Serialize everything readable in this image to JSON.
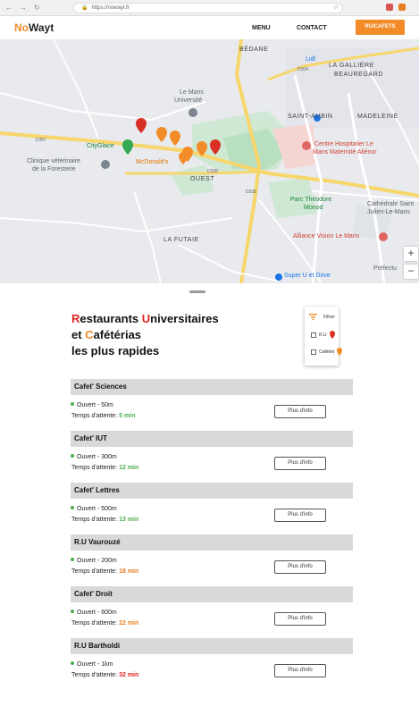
{
  "browser": {
    "url": "https://nowayt.fr"
  },
  "header": {
    "logo_no": "No",
    "logo_wayt": "Wayt",
    "menu_label": "MENU",
    "contact_label": "CONTACT",
    "cta_label": "RU/CAFETS"
  },
  "map": {
    "labels": {
      "bedane": "BÉDANE",
      "lidl": "Lidl",
      "gailliere": "LA GALLIÈRE",
      "beauregard": "BEAUREGARD",
      "universite": "Le Mans",
      "universite2": "Université",
      "saint_aubin": "SAINT-AUBIN",
      "madeleine": "MADELEINE",
      "cityglace": "CityGlace",
      "mcdonalds": "McDonald's",
      "hopital": "Centre Hospitalier Le",
      "hopital2": "Mans Maternité Aliénor",
      "clinique": "Clinique vétérinaire",
      "clinique2": "de la Foresterie",
      "ouest": "OUEST",
      "parc": "Parc Théodore",
      "parc2": "Monod",
      "cathedrale": "Cathédrale Saint",
      "cathedrale2": "Julien-Le-Mans",
      "futaie": "LA FUTAIE",
      "alliance": "Alliance Vision Le Mans",
      "super_u": "Super U et Drive",
      "prefecture": "Préfectu",
      "d357": "D357",
      "d338": "D338",
      "d304": "D304",
      "d338b": "D338"
    },
    "zoom_in": "+",
    "zoom_out": "−"
  },
  "title": {
    "l1a": "R",
    "l1b": "estaurants ",
    "l1c": "U",
    "l1d": "niversitaires",
    "l2a": "et ",
    "l2b": "C",
    "l2c": "afétérias",
    "l3": "les plus rapides"
  },
  "filter": {
    "label": "Filtrer",
    "ru": "R.U",
    "cafet": "Cafétés"
  },
  "restaurants": [
    {
      "name": "Cafet' Sciences",
      "status": "Ouvert - 50m",
      "wait_label": "Temps d'attente: ",
      "wait": "5 min",
      "wait_color": "#4caf50",
      "more": "Plus d'info"
    },
    {
      "name": "Cafet' IUT",
      "status": "Ouvert - 300m",
      "wait_label": "Temps d'attente: ",
      "wait": "12 min",
      "wait_color": "#4caf50",
      "more": "Plus d'info"
    },
    {
      "name": "Cafet' Lettres",
      "status": "Ouvert - 500m",
      "wait_label": "Temps d'attente: ",
      "wait": "13 min",
      "wait_color": "#4caf50",
      "more": "Plus d'info"
    },
    {
      "name": "R.U Vaurouzé",
      "status": "Ouvert - 200m",
      "wait_label": "Temps d'attente: ",
      "wait": "18 min",
      "wait_color": "#e67e22",
      "more": "Plus d'info"
    },
    {
      "name": "Cafet' Droit",
      "status": "Ouvert - 600m",
      "wait_label": "Temps d'attente: ",
      "wait": "22 min",
      "wait_color": "#e67e22",
      "more": "Plus d'info"
    },
    {
      "name": "R.U Bartholdi",
      "status": "Ouvert - 1km",
      "wait_label": "Temps d'attente: ",
      "wait": "32 min",
      "wait_color": "#e0241c",
      "more": "Plus d'info"
    }
  ],
  "colors": {
    "accent": "#f28c28",
    "red": "#e0241c",
    "green": "#4caf50",
    "orange": "#e67e22"
  }
}
